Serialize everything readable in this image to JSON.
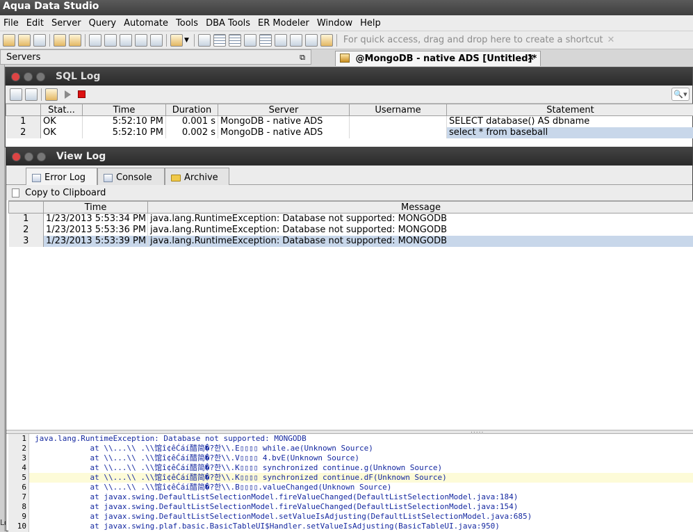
{
  "app": {
    "title": "Aqua Data Studio"
  },
  "menu": [
    "File",
    "Edit",
    "Server",
    "Query",
    "Automate",
    "Tools",
    "DBA Tools",
    "ER Modeler",
    "Window",
    "Help"
  ],
  "toolbar": {
    "shortcut_hint": "For quick access, drag and drop here to create a shortcut",
    "hint_close": "✕"
  },
  "servers_panel": {
    "label": "Servers",
    "pin_glyph": "⧉"
  },
  "doc_tab": {
    "label": "@MongoDB - native ADS [Untitled]*",
    "close": "✕"
  },
  "left_strip": {
    "label": "Lo"
  },
  "sql_log": {
    "title": "SQL Log",
    "search_glyph": "🔍▾",
    "columns": [
      "",
      "Stat...",
      "Time",
      "Duration",
      "Server",
      "Username",
      "Statement"
    ],
    "rows": [
      {
        "num": "1",
        "status": "OK",
        "time": "5:52:10 PM",
        "duration": "0.001 s",
        "server": "MongoDB - native ADS",
        "username": "",
        "statement": "SELECT database() AS dbname"
      },
      {
        "num": "2",
        "status": "OK",
        "time": "5:52:10 PM",
        "duration": "0.002 s",
        "server": "MongoDB - native ADS",
        "username": "",
        "statement": "select * from baseball"
      }
    ]
  },
  "view_log": {
    "title": "View Log",
    "tabs": [
      {
        "label": "Error Log",
        "active": true
      },
      {
        "label": "Console",
        "active": false
      },
      {
        "label": "Archive",
        "active": false
      }
    ],
    "copy_label": "Copy to Clipboard",
    "columns": [
      "",
      "Time",
      "Message"
    ],
    "rows": [
      {
        "num": "1",
        "time": "1/23/2013 5:53:34 PM",
        "message": "java.lang.RuntimeException: Database not supported: MONGODB"
      },
      {
        "num": "2",
        "time": "1/23/2013 5:53:36 PM",
        "message": "java.lang.RuntimeException: Database not supported: MONGODB"
      },
      {
        "num": "3",
        "time": "1/23/2013 5:53:39 PM",
        "message": "java.lang.RuntimeException: Database not supported: MONGODB"
      }
    ],
    "split_handle": "....."
  },
  "stacktrace": {
    "line_numbers": [
      "1",
      "2",
      "3",
      "4",
      "5",
      "6",
      "7",
      "8",
      "9",
      "10"
    ],
    "lines": [
      "java.lang.RuntimeException: Database not supported: MONGODB",
      "            at \\\\...\\\\ .\\\\馆î¢êĆáí醋简�?한\\\\.E▯▯▯▯ while.ae(Unknown Source)",
      "            at \\\\...\\\\ .\\\\馆î¢êĆáí醋简�?한\\\\.V▯▯▯▯ 4.bvE(Unknown Source)",
      "            at \\\\...\\\\ .\\\\馆î¢êĆáí醋简�?한\\\\.K▯▯▯▯ synchronized continue.g(Unknown Source)",
      "            at \\\\...\\\\ .\\\\馆î¢êĆáí醋简�?한\\\\.K▯▯▯▯ synchronized continue.dF(Unknown Source)",
      "            at \\\\...\\\\ .\\\\馆î¢êĆáí醋简�?한\\\\.B▯▯▯▯.valueChanged(Unknown Source)",
      "            at javax.swing.DefaultListSelectionModel.fireValueChanged(DefaultListSelectionModel.java:184)",
      "            at javax.swing.DefaultListSelectionModel.fireValueChanged(DefaultListSelectionModel.java:154)",
      "            at javax.swing.DefaultListSelectionModel.setValueIsAdjusting(DefaultListSelectionModel.java:685)",
      "            at javax.swing.plaf.basic.BasicTableUI$Handler.setValueIsAdjusting(BasicTableUI.java:950)"
    ]
  }
}
